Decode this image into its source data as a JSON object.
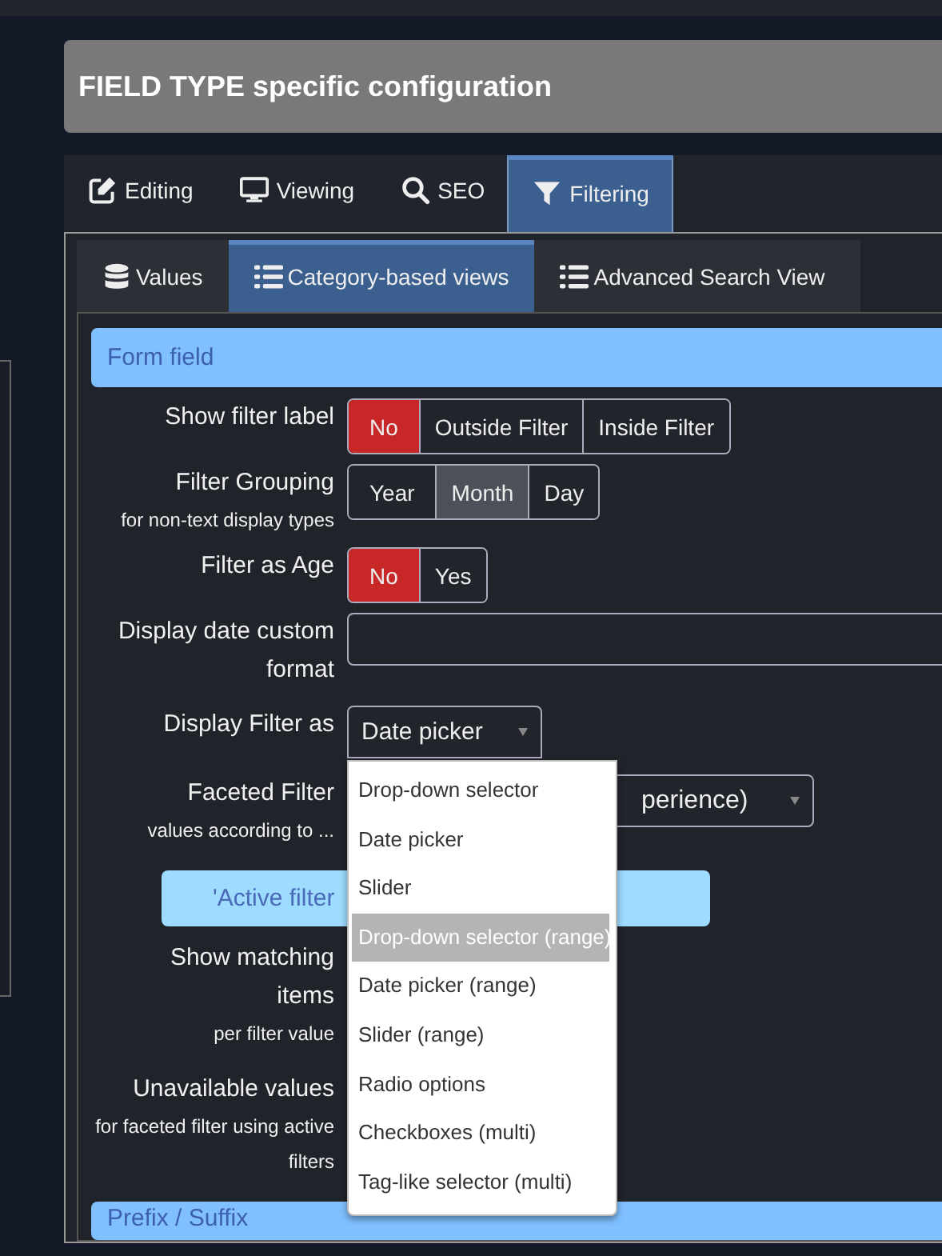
{
  "header": {
    "title": "FIELD TYPE specific configuration"
  },
  "tabs": [
    {
      "label": "Editing",
      "selected": false
    },
    {
      "label": "Viewing",
      "selected": false
    },
    {
      "label": "SEO",
      "selected": false
    },
    {
      "label": "Filtering",
      "selected": true
    }
  ],
  "subtabs": [
    {
      "label": "Values",
      "selected": false
    },
    {
      "label": "Category-based views",
      "selected": true
    },
    {
      "label": "Advanced Search View",
      "selected": false
    }
  ],
  "form_field": {
    "title": "Form field",
    "rows": [
      {
        "kind": "danger_toggle",
        "label": "Show filter label",
        "options": [
          {
            "label": "No",
            "selected": true
          },
          {
            "label": "Outside Filter",
            "selected": false
          },
          {
            "label": "Inside Filter",
            "selected": false
          }
        ]
      },
      {
        "kind": "toggle",
        "label": "Filter Grouping",
        "sublabel": "for non-text display types",
        "options": [
          {
            "label": "Year",
            "selected": false
          },
          {
            "label": "Month",
            "selected": true
          },
          {
            "label": "Day",
            "selected": false
          }
        ]
      },
      {
        "kind": "danger_toggle",
        "label": "Filter as Age",
        "options": [
          {
            "label": "No",
            "selected": true
          },
          {
            "label": "Yes",
            "selected": false
          }
        ]
      },
      {
        "kind": "text_input",
        "label": "Display date custom format"
      },
      {
        "kind": "select",
        "label": "Display Filter as",
        "value": "Date picker",
        "expanded": true,
        "options": [
          {
            "label": "Drop-down selector",
            "highlighted": false
          },
          {
            "label": "Date picker",
            "highlighted": false
          },
          {
            "label": "Slider",
            "highlighted": false
          },
          {
            "label": "Drop-down selector (range)",
            "highlighted": true
          },
          {
            "label": "Date picker (range)",
            "highlighted": false
          },
          {
            "label": "Slider (range)",
            "highlighted": false
          },
          {
            "label": "Radio options",
            "highlighted": false
          },
          {
            "label": "Checkboxes (multi)",
            "highlighted": false
          },
          {
            "label": "Tag-like selector (multi)",
            "highlighted": false
          }
        ]
      },
      {
        "kind": "select",
        "label": "Faceted Filter",
        "sublabel": "values according to ...",
        "value": "perience)",
        "expanded": false
      },
      {
        "kind": "notice",
        "text": "'Active filter"
      },
      {
        "kind": "label_only",
        "label": "Show matching items",
        "sublabel": "per filter value"
      },
      {
        "kind": "label_only",
        "label": "Unavailable values",
        "sublabel": "for faceted filter using active filters"
      }
    ]
  },
  "prefix_suffix": {
    "title": "Prefix / Suffix"
  }
}
